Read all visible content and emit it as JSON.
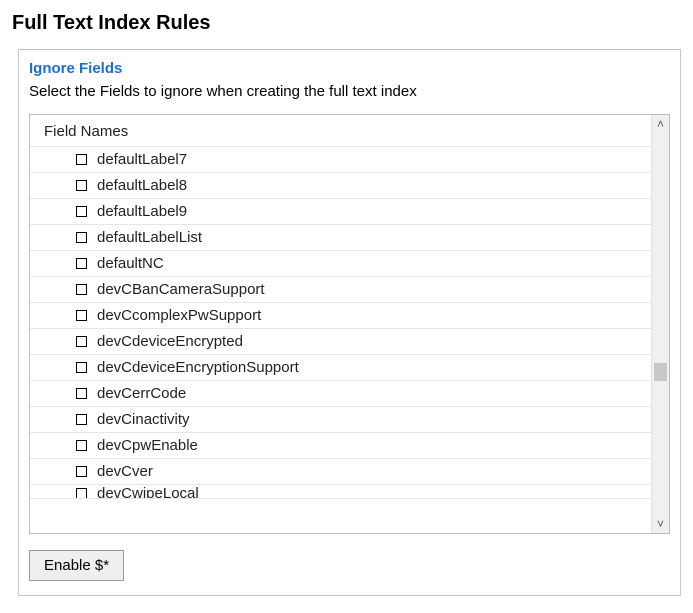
{
  "title": "Full Text Index Rules",
  "panel": {
    "subheading": "Ignore Fields",
    "instruction": "Select the Fields to ignore when creating the full text index",
    "columnHeader": "Field Names",
    "fields": [
      "defaultLabel7",
      "defaultLabel8",
      "defaultLabel9",
      "defaultLabelList",
      "defaultNC",
      "devCBanCameraSupport",
      "devCcomplexPwSupport",
      "devCdeviceEncrypted",
      "devCdeviceEncryptionSupport",
      "devCerrCode",
      "devCinactivity",
      "devCpwEnable",
      "devCver",
      "devCwipeLocal"
    ],
    "enableButton": "Enable $*"
  }
}
